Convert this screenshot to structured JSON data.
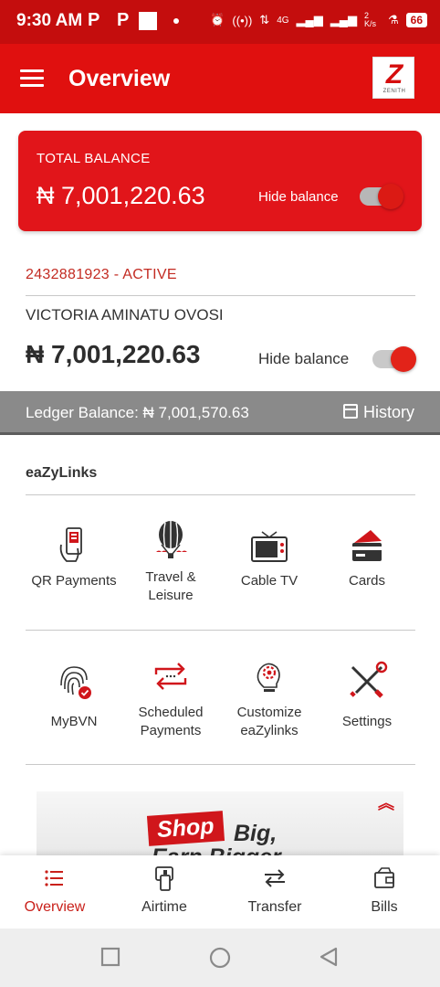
{
  "status_bar": {
    "time": "9:30 AM",
    "notif_1": "P",
    "notif_2": "P",
    "net_type": "4G",
    "speed": "2 K/s",
    "battery": "66"
  },
  "app_bar": {
    "title": "Overview",
    "logo_text": "ZENITH"
  },
  "total_balance": {
    "label": "TOTAL BALANCE",
    "amount": "₦ 7,001,220.63",
    "hide_label": "Hide balance",
    "hidden": false
  },
  "account": {
    "number_status": "2432881923  - ACTIVE",
    "name": "VICTORIA AMINATU OVOSI",
    "balance": "₦ 7,001,220.63",
    "hide_label": "Hide balance"
  },
  "ledger": {
    "text": "Ledger Balance: ₦ 7,001,570.63",
    "history_label": "History"
  },
  "eazylinks": {
    "title": "eaZyLinks",
    "items": [
      {
        "label": "QR Payments",
        "icon": "qr-phone-icon"
      },
      {
        "label": "Travel & Leisure",
        "icon": "hot-air-balloon-icon"
      },
      {
        "label": "Cable TV",
        "icon": "tv-icon"
      },
      {
        "label": "Cards",
        "icon": "cards-icon"
      },
      {
        "label": "MyBVN",
        "icon": "fingerprint-icon"
      },
      {
        "label": "Scheduled Payments",
        "icon": "repeat-arrows-icon"
      },
      {
        "label": "Customize eaZylinks",
        "icon": "lightbulb-gear-icon"
      },
      {
        "label": "Settings",
        "icon": "tools-icon"
      }
    ]
  },
  "banner": {
    "shop": "Shop",
    "big": "Big,",
    "earn": "Earn Bigger"
  },
  "bottom_nav": {
    "items": [
      {
        "label": "Overview",
        "icon": "list-icon",
        "active": true
      },
      {
        "label": "Airtime",
        "icon": "phone-airtime-icon",
        "active": false
      },
      {
        "label": "Transfer",
        "icon": "transfer-arrows-icon",
        "active": false
      },
      {
        "label": "Bills",
        "icon": "bills-wallet-icon",
        "active": false
      }
    ]
  },
  "colors": {
    "brand_red": "#e0100f",
    "status_red": "#c40d0d",
    "ledger_gray": "#8a8a8a",
    "accent_text_red": "#c32b22"
  }
}
